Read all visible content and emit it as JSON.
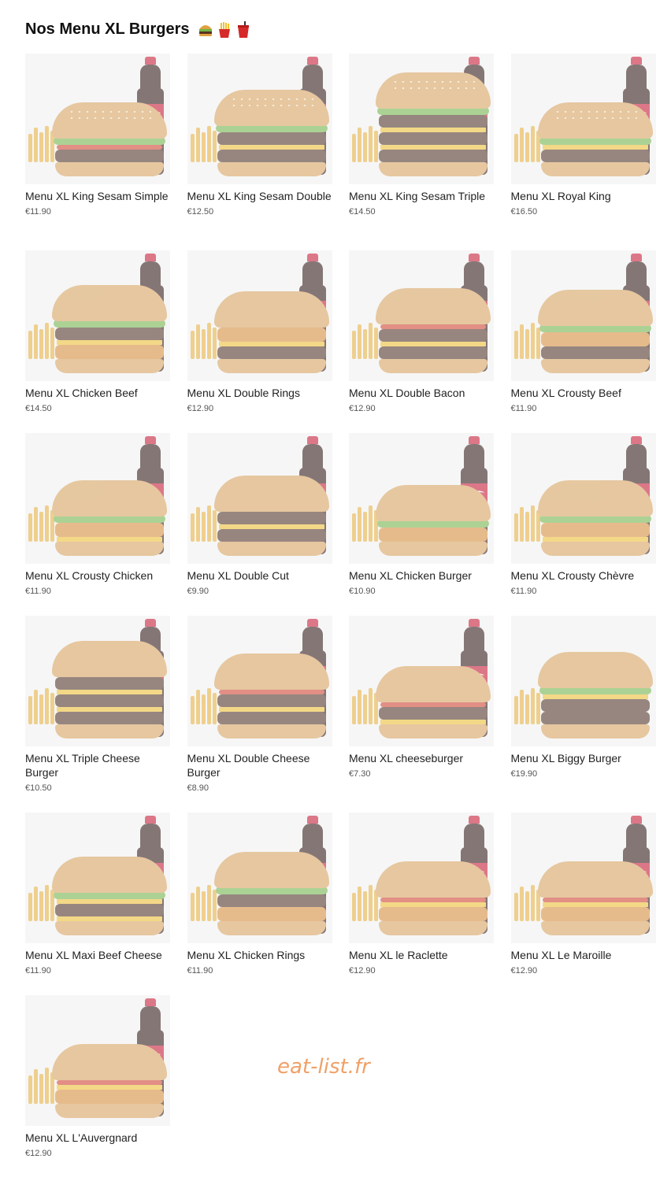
{
  "section": {
    "title": "Nos Menu XL Burgers",
    "title_icons": [
      "burger-emoji",
      "fries-emoji",
      "drink-emoji"
    ]
  },
  "items": [
    {
      "name": "Menu XL King Sesam Simple",
      "price": "€11.90"
    },
    {
      "name": "Menu XL King Sesam Double",
      "price": "€12.50"
    },
    {
      "name": "Menu XL King Sesam Triple",
      "price": "€14.50"
    },
    {
      "name": "Menu XL Royal King",
      "price": "€16.50"
    },
    {
      "name": "Menu XL Chicken Beef",
      "price": "€14.50"
    },
    {
      "name": "Menu XL Double Rings",
      "price": "€12.90"
    },
    {
      "name": "Menu XL Double Bacon",
      "price": "€12.90"
    },
    {
      "name": "Menu XL Crousty Beef",
      "price": "€11.90"
    },
    {
      "name": "Menu XL Crousty Chicken",
      "price": "€11.90"
    },
    {
      "name": "Menu XL Double Cut",
      "price": "€9.90"
    },
    {
      "name": "Menu XL Chicken Burger",
      "price": "€10.90"
    },
    {
      "name": "Menu XL Crousty Chèvre",
      "price": "€11.90"
    },
    {
      "name": "Menu XL Triple Cheese Burger",
      "price": "€10.50"
    },
    {
      "name": "Menu XL Double Cheese Burger",
      "price": "€8.90"
    },
    {
      "name": "Menu XL cheeseburger",
      "price": "€7.30"
    },
    {
      "name": "Menu XL Biggy Burger",
      "price": "€19.90"
    },
    {
      "name": "Menu XL Maxi Beef Cheese",
      "price": "€11.90"
    },
    {
      "name": "Menu XL Chicken Rings",
      "price": "€11.90"
    },
    {
      "name": "Menu XL le Raclette",
      "price": "€12.90"
    },
    {
      "name": "Menu XL Le Maroille",
      "price": "€12.90"
    },
    {
      "name": "Menu XL L'Auvergnard",
      "price": "€12.90"
    }
  ],
  "watermark": "eat-list.fr",
  "colors": {
    "watermark": "#f0a068",
    "thumb_bg": "#f6f6f6",
    "price_text": "#555555"
  }
}
